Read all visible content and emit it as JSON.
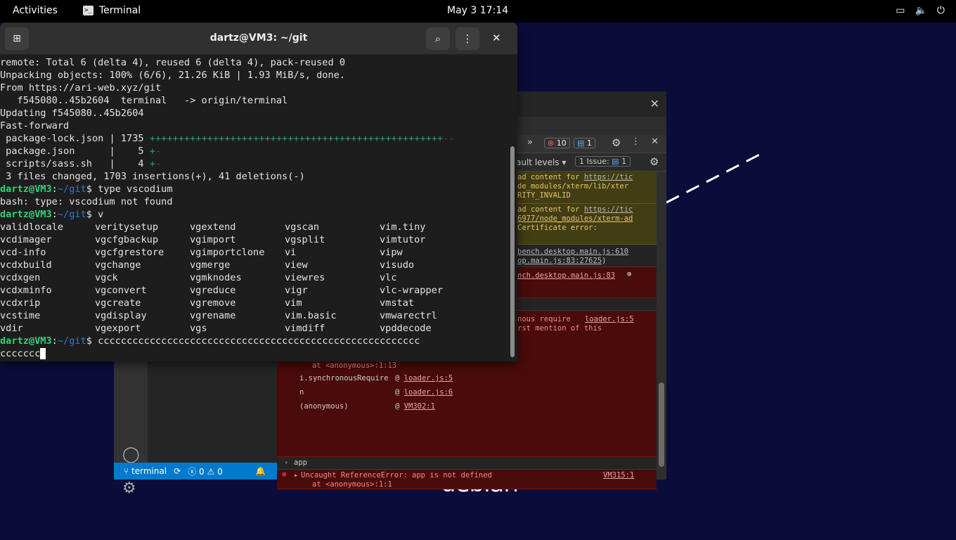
{
  "topbar": {
    "activities": "Activities",
    "app_name": "Terminal",
    "clock": "May 3  17:14",
    "tray_icons": [
      "screen-icon",
      "volume-icon",
      "power-icon"
    ]
  },
  "wallpaper": {
    "logo_text": "debian"
  },
  "vscode": {
    "status": {
      "branch": "terminal",
      "errors": "0",
      "warnings": "0"
    },
    "devtools": {
      "error_count": "10",
      "message_count": "1",
      "levels_label": "ault levels",
      "issues_label": "1 Issue:",
      "issues_count": "1",
      "console": {
        "w1_a": "ad content for ",
        "w1_link": "https://tic",
        "w1_b": "de_modules/xterm/lib/xter",
        "w1_c": "RITY_INVALID",
        "w2_a": "ad content for ",
        "w2_link": "https://tic",
        "w2_b": "6977/node_modules/xterm-ad",
        "w2_c": "Certificate error:",
        "p1_a": "bench.desktop.main.js:610",
        "p1_b": "op.main.js:83:27625",
        "e1_link": "nch.desktop.main.js:83",
        "e2_a": "nous require",
        "e2_link": "loader.js:5",
        "e2_b": "rst mention of this",
        "e2_anon": "at <anonymous>:1:13",
        "stack": [
          {
            "fn": "i.synchronousRequire",
            "src": "loader.js:5"
          },
          {
            "fn": "n",
            "src": "loader.js:6"
          },
          {
            "fn": "(anonymous)",
            "src": "VM302:1"
          }
        ],
        "input_echo": "app",
        "ref_error": "Uncaught ReferenceError: app is not defined",
        "ref_error_at": "at <anonymous>:1:1",
        "ref_error_src": "VM315:1"
      }
    }
  },
  "terminal": {
    "title": "dartz@VM3: ~/git",
    "prompt_user": "dartz@VM3",
    "prompt_path": "~/git",
    "lines": {
      "l1": "remote: Total 6 (delta 4), reused 6 (delta 4), pack-reused 0",
      "l2": "Unpacking objects: 100% (6/6), 21.26 KiB | 1.93 MiB/s, done.",
      "l3": "From https://ari-web.xyz/git",
      "l4": "   f545080..45b2604  terminal   -> origin/terminal",
      "l5": "Updating f545080..45b2604",
      "l6": "Fast-forward",
      "l7_name": " package-lock.json | 1735 ",
      "l7_plus": "+++++++++++++++++++++++++++++++++++++++++++++++++++",
      "l7_minus": "--",
      "l8_name": " package.json      |    5 ",
      "l8_plus": "+",
      "l8_minus": "-",
      "l9_name": " scripts/sass.sh   |    4 ",
      "l9_plus": "+",
      "l9_minus": "-",
      "l10": " 3 files changed, 1703 insertions(+), 41 deletions(-)",
      "cmd1": "type vscodium",
      "out1": "bash: type: vscodium not found",
      "cmd2": "v",
      "cmd3": "cccccccccccccccccccccccccccccccccccccccccccccccccccccccc",
      "cmd3_wrap": "ccccccc"
    },
    "completions": [
      [
        "validlocale",
        "veritysetup",
        "vgextend",
        "vgscan",
        "vim.tiny"
      ],
      [
        "vcdimager",
        "vgcfgbackup",
        "vgimport",
        "vgsplit",
        "vimtutor"
      ],
      [
        "vcd-info",
        "vgcfgrestore",
        "vgimportclone",
        "vi",
        "vipw"
      ],
      [
        "vcdxbuild",
        "vgchange",
        "vgmerge",
        "view",
        "visudo"
      ],
      [
        "vcdxgen",
        "vgck",
        "vgmknodes",
        "viewres",
        "vlc"
      ],
      [
        "vcdxminfo",
        "vgconvert",
        "vgreduce",
        "vigr",
        "vlc-wrapper"
      ],
      [
        "vcdxrip",
        "vgcreate",
        "vgremove",
        "vim",
        "vmstat"
      ],
      [
        "vcstime",
        "vgdisplay",
        "vgrename",
        "vim.basic",
        "vmwarectrl"
      ],
      [
        "vdir",
        "vgexport",
        "vgs",
        "vimdiff",
        "vpddecode"
      ]
    ]
  }
}
